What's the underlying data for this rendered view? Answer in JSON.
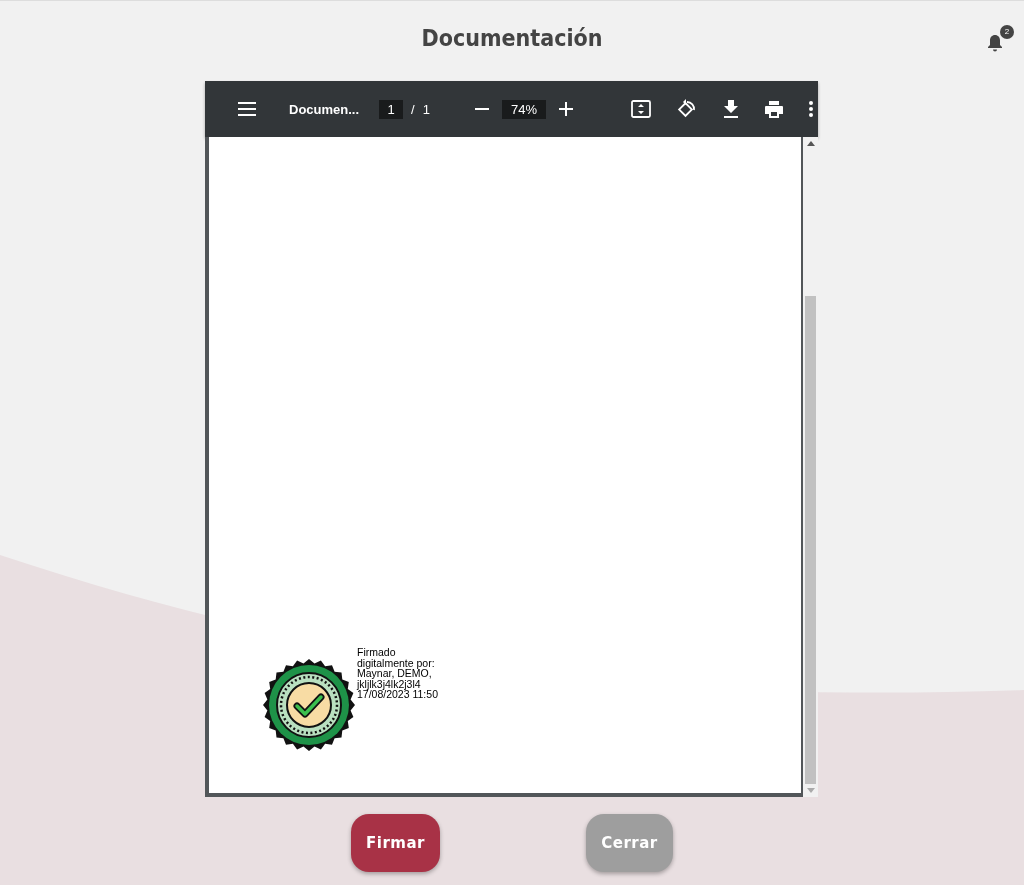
{
  "page": {
    "title": "Documentación"
  },
  "notifications": {
    "count": "2"
  },
  "pdf_viewer": {
    "toolbar": {
      "document_title": "Documen...",
      "page_number": "1",
      "page_separator": "/",
      "page_count": "1",
      "zoom": "74%"
    },
    "signature_stamp": {
      "lines": [
        "Firmado",
        "digitalmente por:",
        "Maynar, DEMO,",
        "jkljlk3j4lk2j3l4",
        "17/08/2023 11:50"
      ]
    }
  },
  "buttons": [
    {
      "label": "Firmar",
      "kind": "primary"
    },
    {
      "label": "Cerrar",
      "kind": "secondary"
    }
  ]
}
